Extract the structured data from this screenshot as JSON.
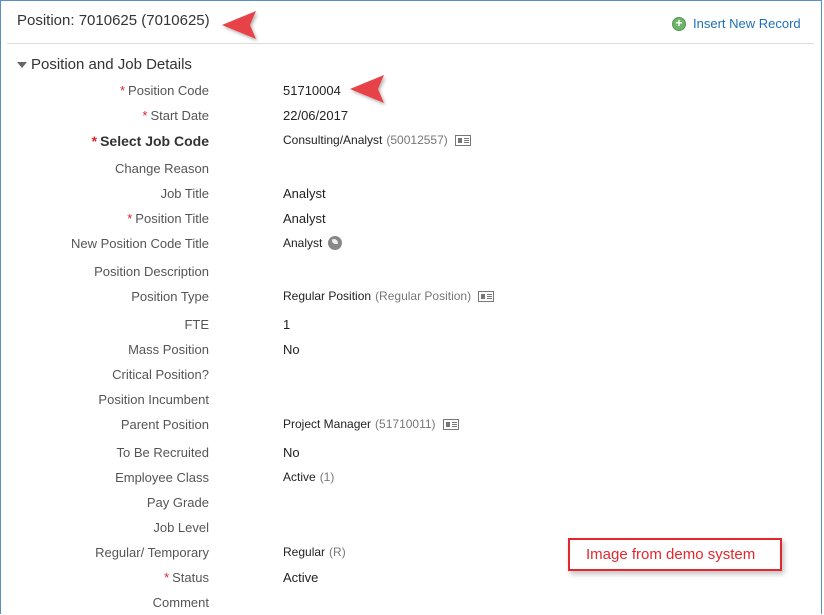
{
  "header": {
    "title": "Position: 7010625 (7010625)",
    "insert_label": "Insert New Record"
  },
  "section": {
    "label": "Position and Job Details"
  },
  "fields": [
    {
      "label": "Position Code",
      "required": "*",
      "value": "51710004",
      "code": "",
      "icon": ""
    },
    {
      "label": "Start Date",
      "required": "*",
      "value": "22/06/2017",
      "code": "",
      "icon": ""
    },
    {
      "label": "Select Job Code",
      "required": "*",
      "value": "Consulting/Analyst",
      "code": "(50012557)",
      "icon": "card-icon"
    },
    {
      "label": "Change Reason",
      "required": "",
      "value": "",
      "code": "",
      "icon": ""
    },
    {
      "label": "Job Title",
      "required": "",
      "value": "Analyst",
      "code": "",
      "icon": ""
    },
    {
      "label": "Position Title",
      "required": "*",
      "value": "Analyst",
      "code": "",
      "icon": ""
    },
    {
      "label": "New Position Code Title",
      "required": "",
      "value": "Analyst",
      "code": "",
      "icon": "globe-icon"
    },
    {
      "label": "Position Description",
      "required": "",
      "value": "",
      "code": "",
      "icon": ""
    },
    {
      "label": "Position Type",
      "required": "",
      "value": "Regular Position",
      "code": "(Regular Position)",
      "icon": "card-icon"
    },
    {
      "label": "FTE",
      "required": "",
      "value": "1",
      "code": "",
      "icon": ""
    },
    {
      "label": "Mass Position",
      "required": "",
      "value": "No",
      "code": "",
      "icon": ""
    },
    {
      "label": "Critical Position?",
      "required": "",
      "value": "",
      "code": "",
      "icon": ""
    },
    {
      "label": "Position Incumbent",
      "required": "",
      "value": "",
      "code": "",
      "icon": ""
    },
    {
      "label": "Parent Position",
      "required": "",
      "value": "Project Manager",
      "code": "(51710011)",
      "icon": "card-icon"
    },
    {
      "label": "To Be Recruited",
      "required": "",
      "value": "No",
      "code": "",
      "icon": ""
    },
    {
      "label": "Employee Class",
      "required": "",
      "value": "Active",
      "code": "(1)",
      "icon": ""
    },
    {
      "label": "Pay Grade",
      "required": "",
      "value": "",
      "code": "",
      "icon": ""
    },
    {
      "label": "Job Level",
      "required": "",
      "value": "",
      "code": "",
      "icon": ""
    },
    {
      "label": "Regular/ Temporary",
      "required": "",
      "value": "Regular",
      "code": "(R)",
      "icon": ""
    },
    {
      "label": "Status",
      "required": "*",
      "value": "Active",
      "code": "",
      "icon": ""
    },
    {
      "label": "Comment",
      "required": "",
      "value": "",
      "code": "",
      "icon": ""
    }
  ],
  "annotation": {
    "text": "Image from demo system",
    "color": "#e4262e"
  },
  "colors": {
    "link": "#1f6fb8",
    "required": "#e0202a",
    "arrow": "#e8434a"
  }
}
